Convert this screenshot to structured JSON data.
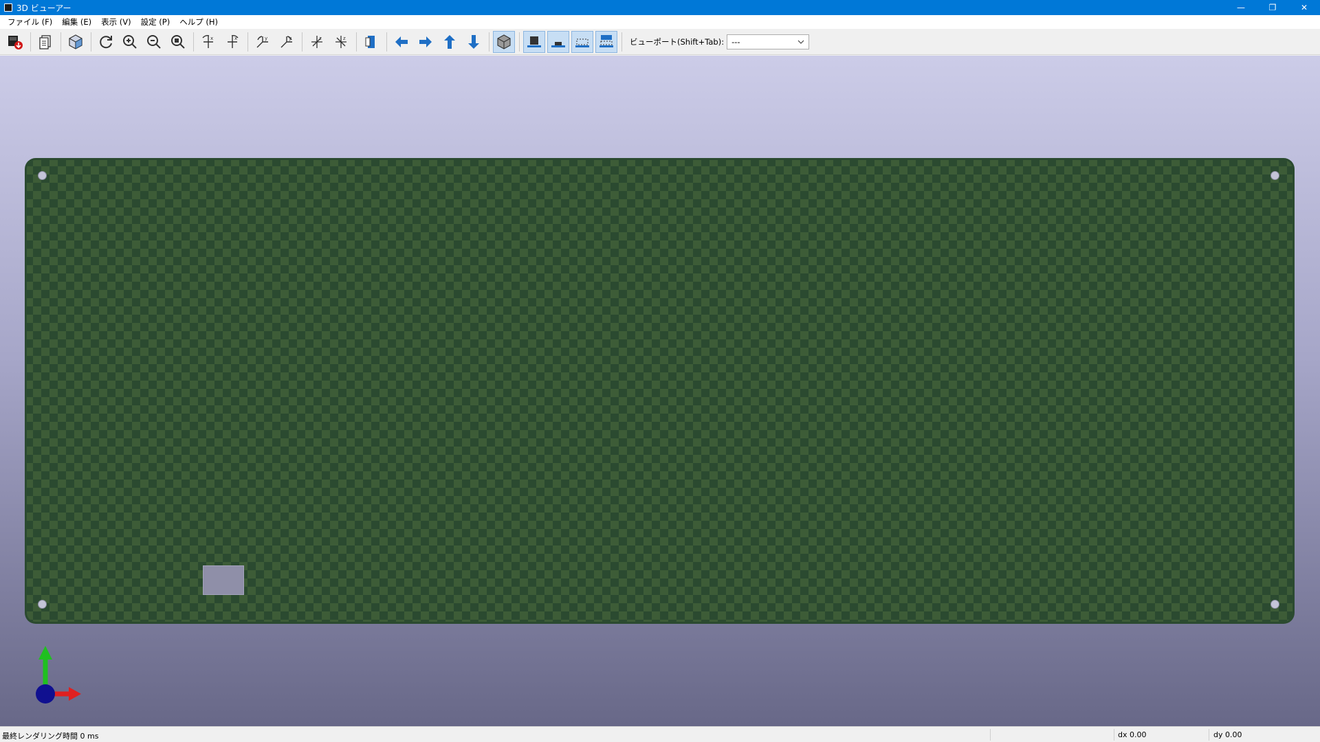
{
  "window": {
    "title": "3D ビューアー",
    "minimize": "—",
    "restore": "❐",
    "close": "✕"
  },
  "menubar": {
    "items": [
      {
        "label": "ファイル (F)"
      },
      {
        "label": "編集 (E)"
      },
      {
        "label": "表示 (V)"
      },
      {
        "label": "設定 (P)"
      },
      {
        "label": "ヘルプ (H)"
      }
    ]
  },
  "toolbar": {
    "viewport_label": "ビューポート(Shift+Tab):",
    "viewport_value": "---",
    "icons": [
      "export-image-icon",
      "copy-icon",
      "raytracing-cube-icon",
      "reload-icon",
      "zoom-in-icon",
      "zoom-out-icon",
      "zoom-fit-icon",
      "rotate-x-cw-icon",
      "rotate-x-ccw-icon",
      "rotate-y-cw-icon",
      "rotate-y-ccw-icon",
      "rotate-z-cw-icon",
      "rotate-z-ccw-icon",
      "flip-board-icon",
      "pan-left-icon",
      "pan-right-icon",
      "pan-up-icon",
      "pan-down-icon",
      "orthographic-icon",
      "show-tht-icon",
      "show-smd-icon",
      "show-virtual-icon",
      "show-not-in-pos-icon"
    ]
  },
  "colors": {
    "titlebar": "#0078d7",
    "board": "#2b4a30",
    "board_check": "#3d5c37",
    "axis_x": "#e02020",
    "axis_y": "#20c020",
    "axis_z": "#101090",
    "icon_blue": "#1f6fc5"
  },
  "statusbar": {
    "render_time": "最終レンダリング時間 0 ms",
    "dx": "dx 0.00",
    "dy": "dy 0.00"
  }
}
